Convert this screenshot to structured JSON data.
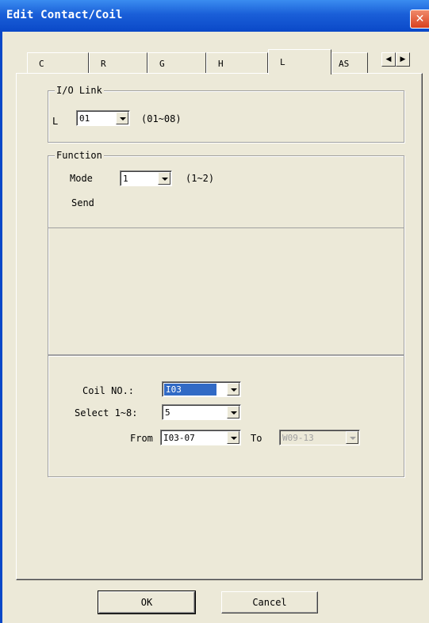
{
  "window": {
    "title": "Edit Contact/Coil"
  },
  "tabs": [
    {
      "label": "C"
    },
    {
      "label": "R"
    },
    {
      "label": "G"
    },
    {
      "label": "H"
    },
    {
      "label": "L",
      "active": true
    },
    {
      "label": "AS"
    }
  ],
  "io_link": {
    "group_label": "I/O Link",
    "field_label": "L",
    "value": "01",
    "range": "(01~08)"
  },
  "function": {
    "group_label": "Function",
    "mode_label": "Mode",
    "mode_value": "1",
    "mode_range": "(1~2)",
    "mode_text": "Send"
  },
  "coil": {
    "coil_no_label": "Coil NO.:",
    "coil_no_value": "I03",
    "select_label": "Select 1~8:",
    "select_value": "5",
    "from_label": "From",
    "from_value": "I03-07",
    "to_label": "To",
    "to_value": "W09-13"
  },
  "buttons": {
    "ok": "OK",
    "cancel": "Cancel"
  },
  "colors": {
    "titlebar": "#0a48c8",
    "face": "#ece9d8",
    "selection": "#316ac5",
    "close": "#d8401e"
  }
}
